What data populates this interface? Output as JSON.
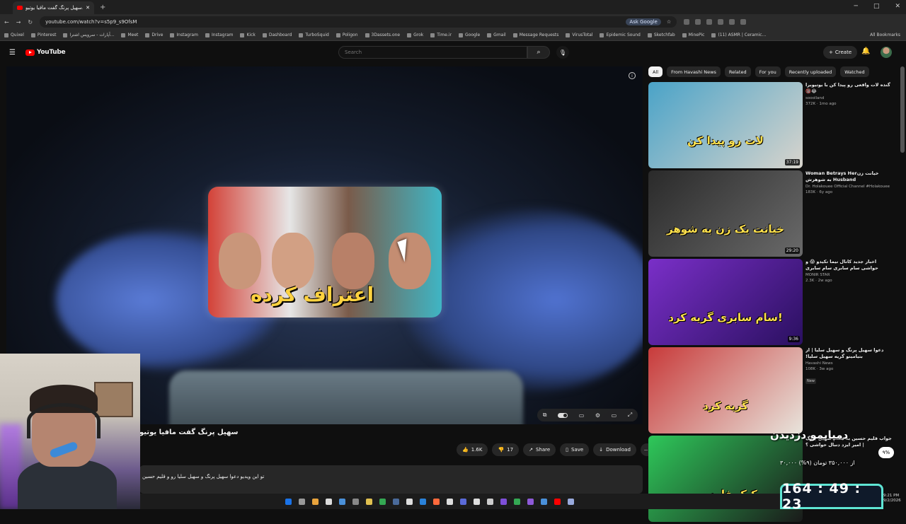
{
  "browser": {
    "tab_title": "سهیل پرنگ گفت مافیا یوتیو...",
    "url": "youtube.com/watch?v=s5p9_s9OfsM",
    "ask_google": "Ask Google",
    "bookmarks": [
      "Quixel",
      "Pinterest",
      "آپارات - سرویس اشترا...",
      "Meet",
      "Drive",
      "Instagram",
      "Instagram",
      "Kick",
      "Dashboard",
      "TurboSquid",
      "Poligon",
      "3Dassets.one",
      "Grok",
      "Time.ir",
      "Google",
      "Gmail",
      "Message Requests",
      "VirusTotal",
      "Epidemic Sound",
      "Sketchfab",
      "MinePic",
      "(11) ASMR | Ceramic..."
    ],
    "all_bookmarks": "All Bookmarks"
  },
  "youtube": {
    "logo": "YouTube",
    "search_placeholder": "Search",
    "create_label": "Create"
  },
  "video": {
    "title": "سهیل پرنگ گفت مافیا یوتیو",
    "thumb_text": "اعتراف کرده",
    "likes": "1.6K",
    "dislikes": "17",
    "share": "Share",
    "save": "Save",
    "download": "Download",
    "description": "تو این ویدیو دعوا سهیل پرنگ و سهیل سلیا رو و قلیم حسین"
  },
  "chips": [
    "All",
    "From Havashi News",
    "Related",
    "For you",
    "Recently uploaded",
    "Watched"
  ],
  "related": [
    {
      "title": "گنده لات واقعی رو پیدا کن با یوتیوبرا 😂🔞",
      "channel": "sooolland",
      "stats": "372K · 1mo ago",
      "duration": "37:19",
      "thumb_text": "لات رو پیدا کن",
      "colors": [
        "#4aa3c8",
        "#d8d4cc"
      ]
    },
    {
      "title": "خیانت زنWoman Betrays Her Husband به شوهرش",
      "channel": "Dr. Holakouee Official Channel #Holakouee",
      "stats": "183K · 6y ago",
      "duration": "29:20",
      "thumb_text": "خیانت یک زن به شوهر",
      "colors": [
        "#2a2a2a",
        "#6a6a6a"
      ]
    },
    {
      "title": "اخبار جدید کانال نیما تکیدو 😱 و حواشی سام سابری سام سابری",
      "channel": "MONIR STAR",
      "stats": "2.3K · 2w ago",
      "duration": "9:36",
      "thumb_text": "سام سابری گریه کرد!",
      "colors": [
        "#7a2fc8",
        "#2a1060"
      ]
    },
    {
      "title": "دعوا سهیل پرنگ و سهیل سلیا | از بتیامینو گریه سهیل سلیا!",
      "channel": "Havashi News",
      "stats": "108K · 3w ago",
      "duration": "",
      "badge": "New",
      "thumb_text": "گریه کرد",
      "colors": [
        "#c83a3a",
        "#e8e4dc"
      ]
    },
    {
      "title": "جواب قلیم حسین به هکت سهیل پرنگ | امیر ایزد دنبال حواشی ؟",
      "channel": "",
      "stats": "",
      "duration": "",
      "thumb_text": "کیک فارسی",
      "colors": [
        "#2ec85a",
        "#1a1a1a"
      ]
    }
  ],
  "overlay": {
    "title": "دمپایمو دزدیدن",
    "price": "۳۰,۰۰۰ از ۳۵۰,۰۰۰ تومان (۹%)",
    "percent": "۹%",
    "timer": "164 : 49 : 23"
  },
  "clock": {
    "time": "9:21 PM",
    "date": "9/2/2026"
  }
}
